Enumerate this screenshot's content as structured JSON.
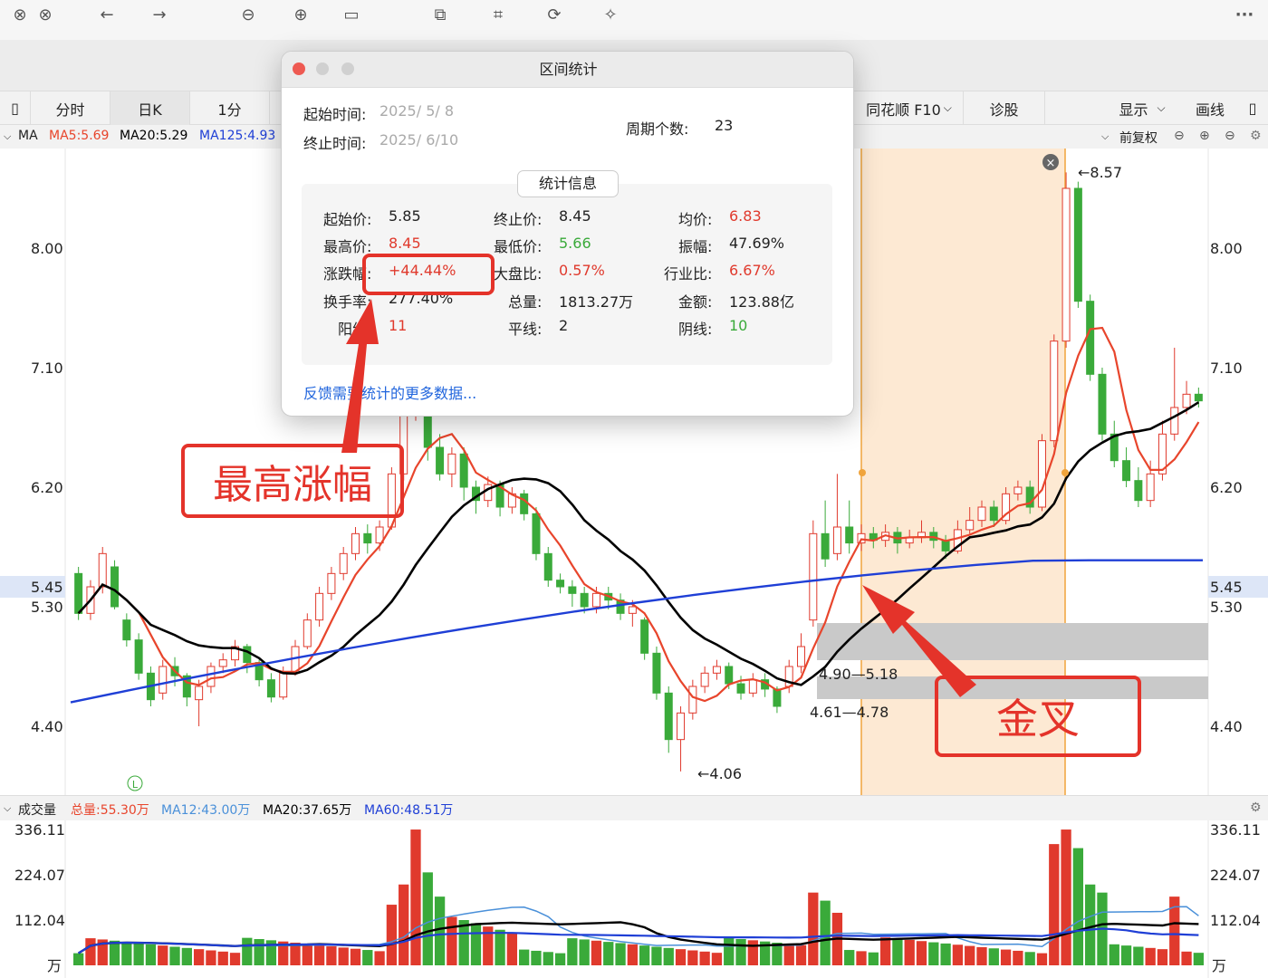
{
  "toolbar": {
    "icons": [
      "close-circle-icon",
      "close-circle-icon",
      "arrow-left-icon",
      "arrow-right-icon",
      "zoom-out-icon",
      "zoom-in-icon",
      "fit-icon",
      "transform-icon",
      "crop-icon",
      "rotate-icon",
      "magic-icon",
      "more-icon"
    ],
    "more_label": "···"
  },
  "tabs": {
    "left": [
      {
        "label": "分时"
      },
      {
        "label": "日K"
      },
      {
        "label": "1分"
      }
    ],
    "f10": "同花顺 F10",
    "diag": "诊股",
    "display": "显示",
    "draw": "画线"
  },
  "ma_bar": {
    "ma": "MA",
    "ma5": "MA5:5.69",
    "ma20": "MA20:5.29",
    "ma125": "MA125:4.93",
    "rights": "前复权"
  },
  "price_axis": {
    "labels": [
      "8.00",
      "7.10",
      "6.20",
      "5.45",
      "5.30",
      "4.40"
    ],
    "values": [
      8.0,
      7.1,
      6.2,
      5.45,
      5.3,
      4.4
    ],
    "current": "5.45"
  },
  "annotations": {
    "high": "←8.57",
    "low": "←4.06",
    "zone1": "4.90—5.18",
    "zone2": "4.61—4.78",
    "l_mark": "L"
  },
  "volume_bar": {
    "label": "成交量",
    "total": "总量:55.30万",
    "ma12": "MA12:43.00万",
    "ma20": "MA20:37.65万",
    "ma60": "MA60:48.51万",
    "axis": [
      "336.11",
      "224.07",
      "112.04"
    ],
    "axis_values": [
      336.11,
      224.07,
      112.04
    ],
    "unit": "万"
  },
  "dialog": {
    "title": "区间统计",
    "start_label": "起始时间:",
    "start_value": "2025/  5/  8",
    "end_label": "终止时间:",
    "end_value": "2025/  6/10",
    "period_label": "周期个数:",
    "period_value": "23",
    "section": "统计信息",
    "stats": [
      {
        "label": "起始价:",
        "value": "5.85",
        "color": "normal"
      },
      {
        "label": "终止价:",
        "value": "8.45",
        "color": "normal"
      },
      {
        "label": "均价:",
        "value": "6.83",
        "color": "red"
      },
      {
        "label": "最高价:",
        "value": "8.45",
        "color": "red"
      },
      {
        "label": "最低价:",
        "value": "5.66",
        "color": "green"
      },
      {
        "label": "振幅:",
        "value": "47.69%",
        "color": "normal"
      },
      {
        "label": "涨跌幅:",
        "value": "+44.44%",
        "color": "red"
      },
      {
        "label": "大盘比:",
        "value": "0.57%",
        "color": "red"
      },
      {
        "label": "行业比:",
        "value": "6.67%",
        "color": "red"
      },
      {
        "label": "换手率:",
        "value": "277.40%",
        "color": "normal"
      },
      {
        "label": "总量:",
        "value": "1813.27万",
        "color": "normal"
      },
      {
        "label": "金额:",
        "value": "123.88亿",
        "color": "normal"
      },
      {
        "label": "阳线:",
        "value": "11",
        "color": "red"
      },
      {
        "label": "平线:",
        "value": "2",
        "color": "normal"
      },
      {
        "label": "阴线:",
        "value": "10",
        "color": "green"
      }
    ],
    "feedback": "反馈需要统计的更多数据..."
  },
  "callouts": {
    "max_rise": "最高涨幅",
    "golden_cross": "金叉"
  },
  "colors": {
    "up": "#e03a2d",
    "down": "#3aaa3a",
    "ma5": "#e8452c",
    "ma20": "#000000",
    "ma125": "#1f3fd6",
    "callout": "#e4332a",
    "highlight": "#fde9d3"
  }
}
